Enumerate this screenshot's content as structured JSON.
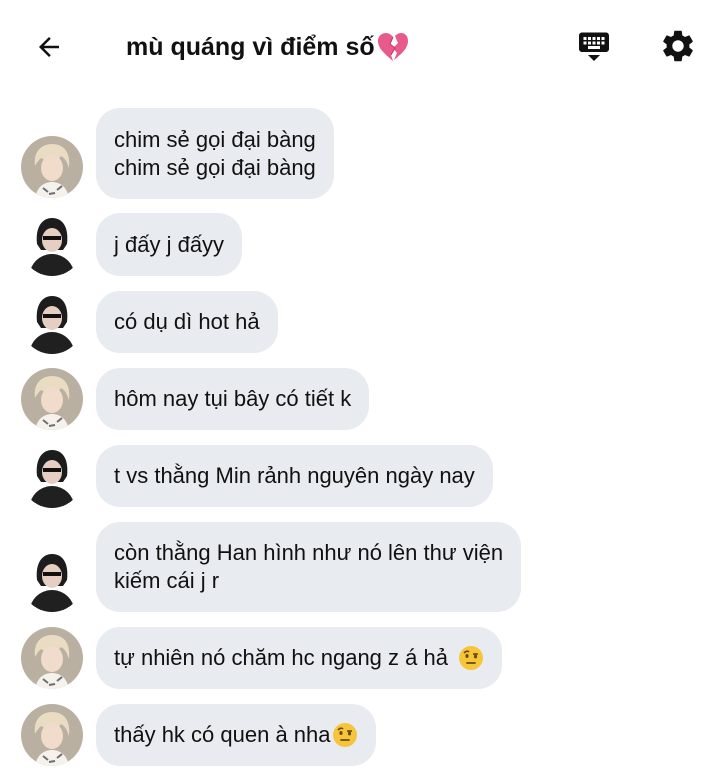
{
  "header": {
    "title": "mù quáng vì điểm số",
    "title_emoji": "broken-heart-emoji",
    "back_icon": "arrow-left-icon",
    "keyboard_icon": "keyboard-icon",
    "settings_icon": "gear-icon"
  },
  "colors": {
    "bubble": "#e8ebef",
    "text": "#111111",
    "broken_heart": "#e85a8a",
    "avatar_blonde_bg": "#b9b0a2",
    "avatar_dark_bg": "#2a2a2a"
  },
  "messages": [
    {
      "sender": "blonde",
      "lines": [
        "chim sẻ gọi đại bàng",
        "chim sẻ gọi đại bàng"
      ]
    },
    {
      "sender": "dark",
      "lines": [
        "j đấy j đấyy"
      ]
    },
    {
      "sender": "dark",
      "lines": [
        "có dụ dì hot hả"
      ]
    },
    {
      "sender": "blonde",
      "lines": [
        "hôm nay tụi bây có tiết k"
      ]
    },
    {
      "sender": "dark",
      "lines": [
        "t vs thằng Min rảnh nguyên ngày nay"
      ]
    },
    {
      "sender": "dark",
      "lines": [
        "còn thằng Han hình như nó lên thư viện",
        "kiếm cái j r"
      ]
    },
    {
      "sender": "blonde",
      "lines": [
        "tự nhiên nó chăm hc ngang z á hả "
      ],
      "emoji": "raised-eyebrow-emoji"
    },
    {
      "sender": "blonde",
      "lines": [
        "thấy hk có quen à nha"
      ],
      "emoji": "raised-eyebrow-emoji"
    }
  ]
}
